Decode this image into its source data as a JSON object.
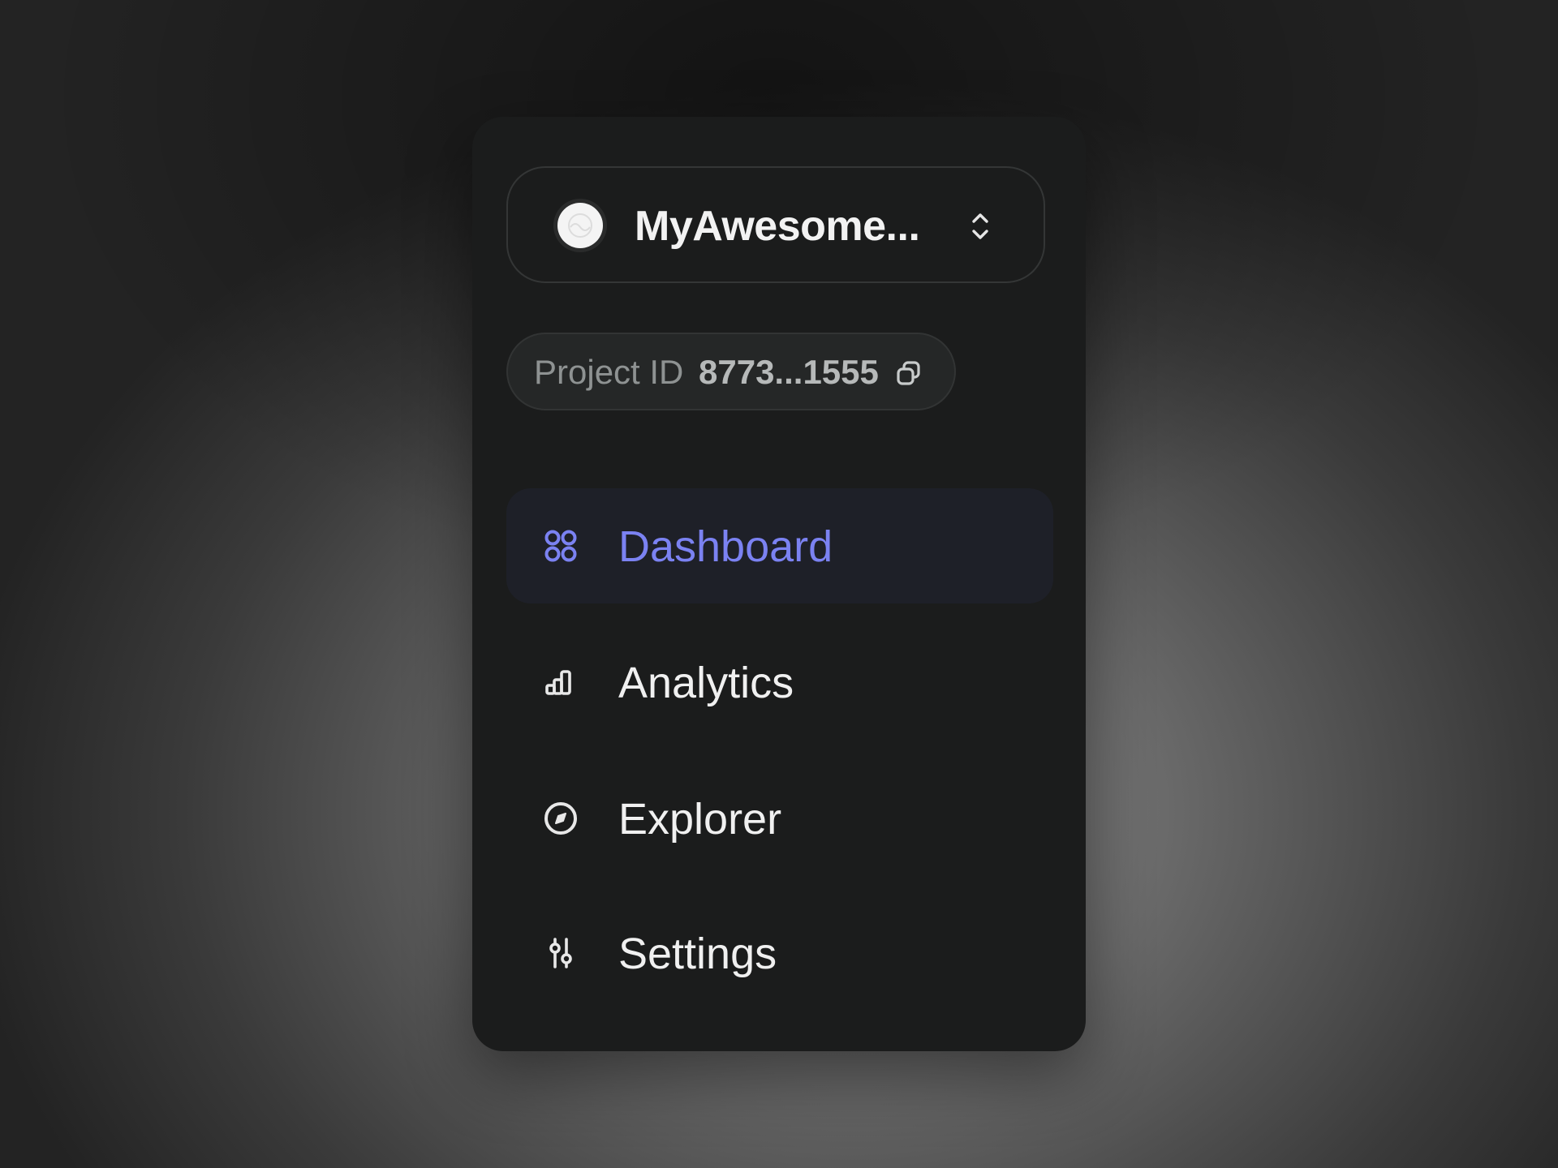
{
  "project": {
    "name": "MyAwesome...",
    "id_label": "Project ID",
    "id_value": "8773...1555"
  },
  "nav": {
    "items": [
      {
        "label": "Dashboard",
        "icon": "grid-icon",
        "active": true
      },
      {
        "label": "Analytics",
        "icon": "bar-chart-icon",
        "active": false
      },
      {
        "label": "Explorer",
        "icon": "compass-icon",
        "active": false
      },
      {
        "label": "Settings",
        "icon": "sliders-icon",
        "active": false
      }
    ]
  },
  "colors": {
    "accent": "#7b82f2",
    "panel": "#1b1c1c",
    "active_bg": "#1e2028",
    "text": "#f0f0f0"
  }
}
